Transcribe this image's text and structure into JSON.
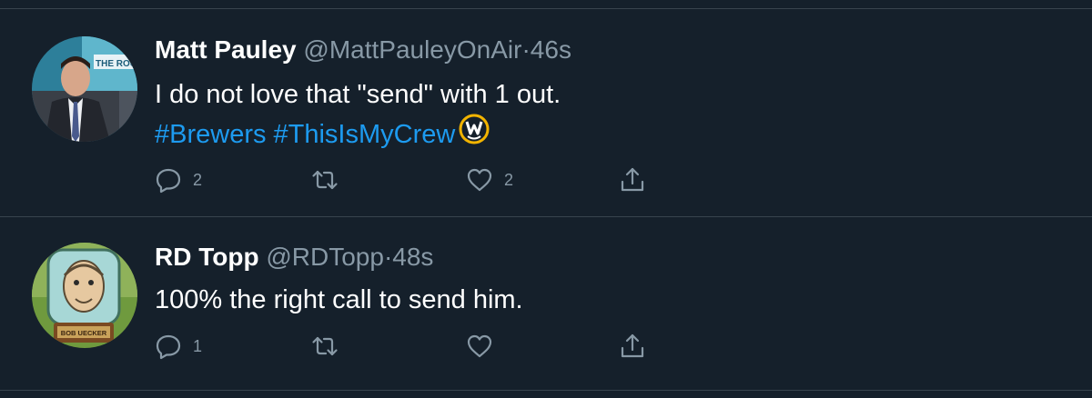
{
  "tweets": [
    {
      "name": "Matt Pauley",
      "handle": "@MattPauleyOnAir",
      "separator": "·",
      "time": "46s",
      "line1": "I do not love that \"send\" with 1 out.",
      "hashtag1": "#Brewers",
      "hashtag2": "#ThisIsMyCrew",
      "avatar_banner": "THE ROU",
      "reply_count": "2",
      "retweet_count": "",
      "like_count": "2"
    },
    {
      "name": "RD Topp",
      "handle": "@RDTopp",
      "separator": "·",
      "time": "48s",
      "line1": "100% the right call to send him.",
      "avatar_plate": "BOB UECKER",
      "reply_count": "1",
      "retweet_count": "",
      "like_count": ""
    }
  ],
  "icons": {
    "reply": "reply-icon",
    "retweet": "retweet-icon",
    "like": "like-icon",
    "share": "share-icon",
    "brewers_logo": "brewers-logo-icon"
  },
  "colors": {
    "background": "#15202b",
    "link": "#1d9bf0",
    "muted": "#8899a6",
    "divider": "#38444d"
  }
}
